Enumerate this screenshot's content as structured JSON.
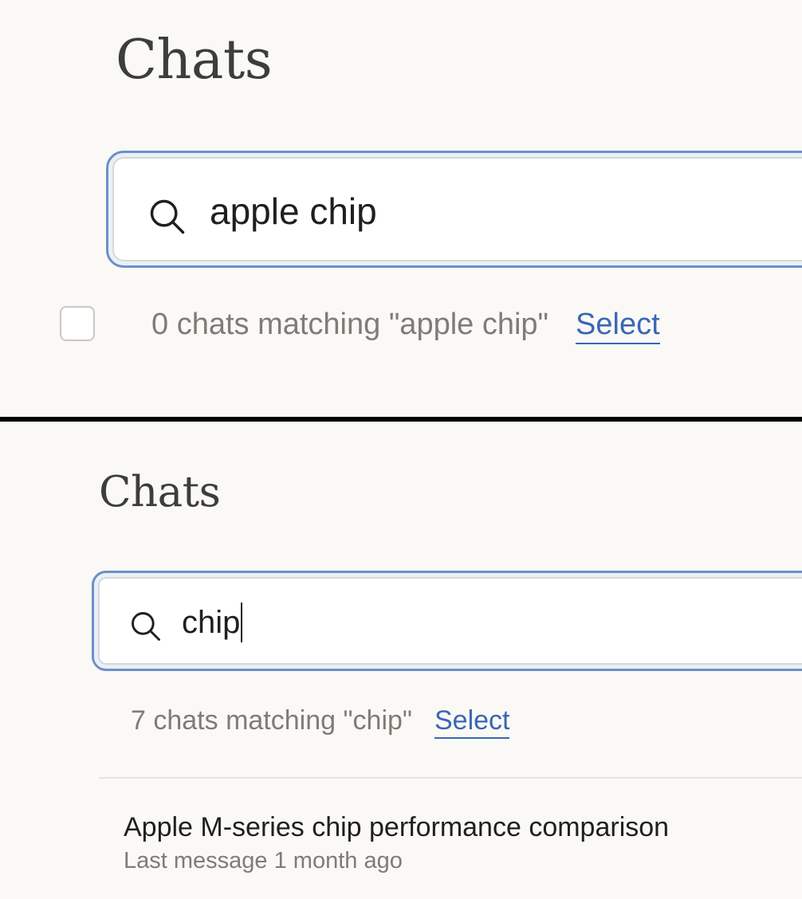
{
  "panels": [
    {
      "page_title": "Chats",
      "search": {
        "value": "apple chip"
      },
      "results": {
        "count_text": "0 chats matching \"apple chip\"",
        "select_label": "Select"
      }
    },
    {
      "page_title": "Chats",
      "search": {
        "value": "chip"
      },
      "results": {
        "count_text": "7 chats matching \"chip\"",
        "select_label": "Select"
      },
      "chats": [
        {
          "title": "Apple M-series chip performance comparison",
          "meta": "Last message 1 month ago"
        }
      ]
    }
  ],
  "colors": {
    "background": "#faf9f6",
    "focus_ring": "#6e8fc7",
    "link": "#3a66b3",
    "muted_text": "#7d7c77",
    "primary_text": "#1f1f1d"
  },
  "icons": {
    "search": "search-icon"
  }
}
